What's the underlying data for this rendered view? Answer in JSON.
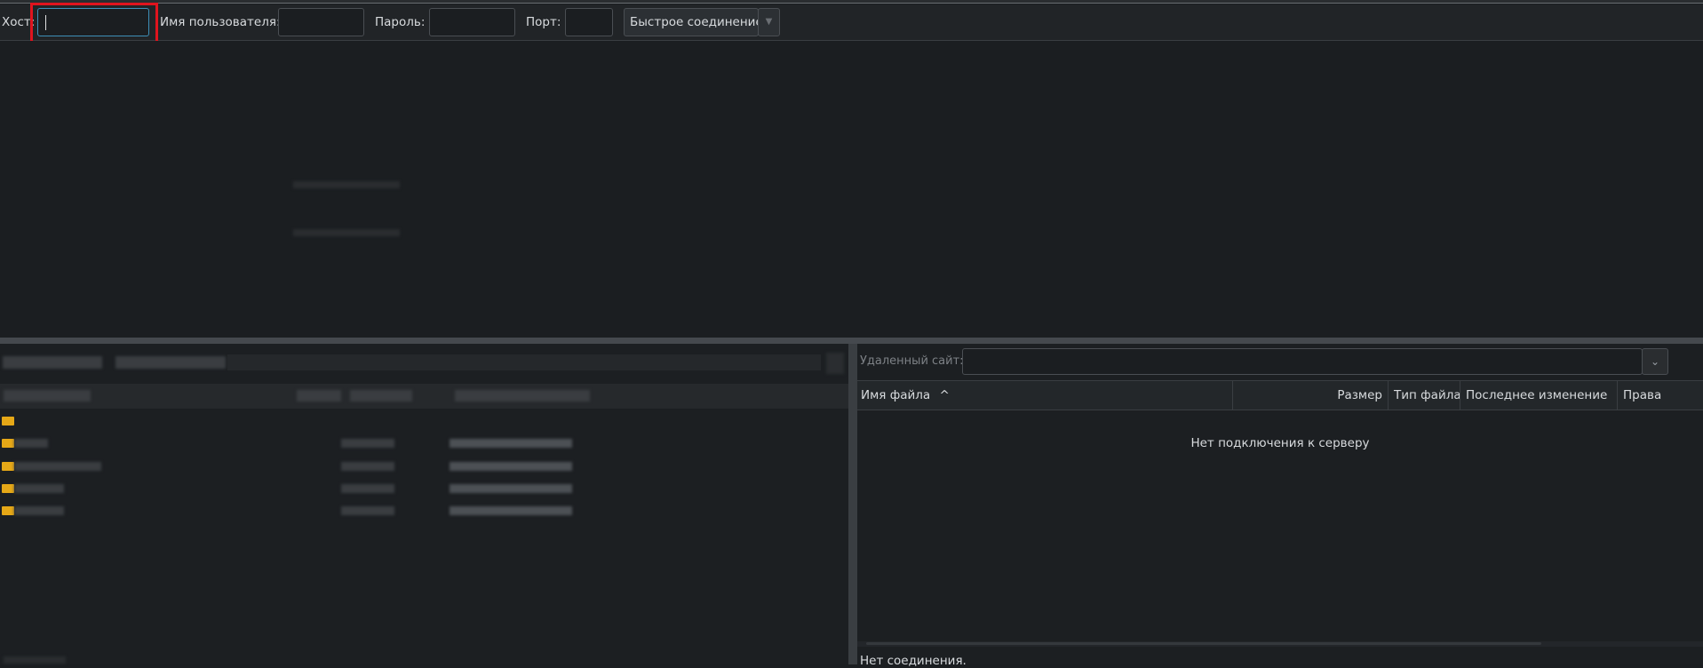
{
  "toolbar": {
    "host_label": "Хост:",
    "host_value": "",
    "username_label": "Имя пользователя:",
    "username_value": "",
    "password_label": "Пароль:",
    "password_value": "",
    "port_label": "Порт:",
    "port_value": "",
    "quickconnect_label": "Быстрое соединение",
    "quickconnect_history_icon": "chevron-down-icon"
  },
  "remote": {
    "site_label": "Удаленный сайт:",
    "site_value": "",
    "columns": [
      "Имя файла",
      "Размер",
      "Тип файла",
      "Последнее изменение",
      "Права"
    ],
    "sort_indicator": "^",
    "empty_message": "Нет подключения к серверу",
    "status": "Нет соединения."
  },
  "colors": {
    "focus_border": "#3d8fb8",
    "highlight": "#e0141e",
    "folder": "#e6a817"
  }
}
